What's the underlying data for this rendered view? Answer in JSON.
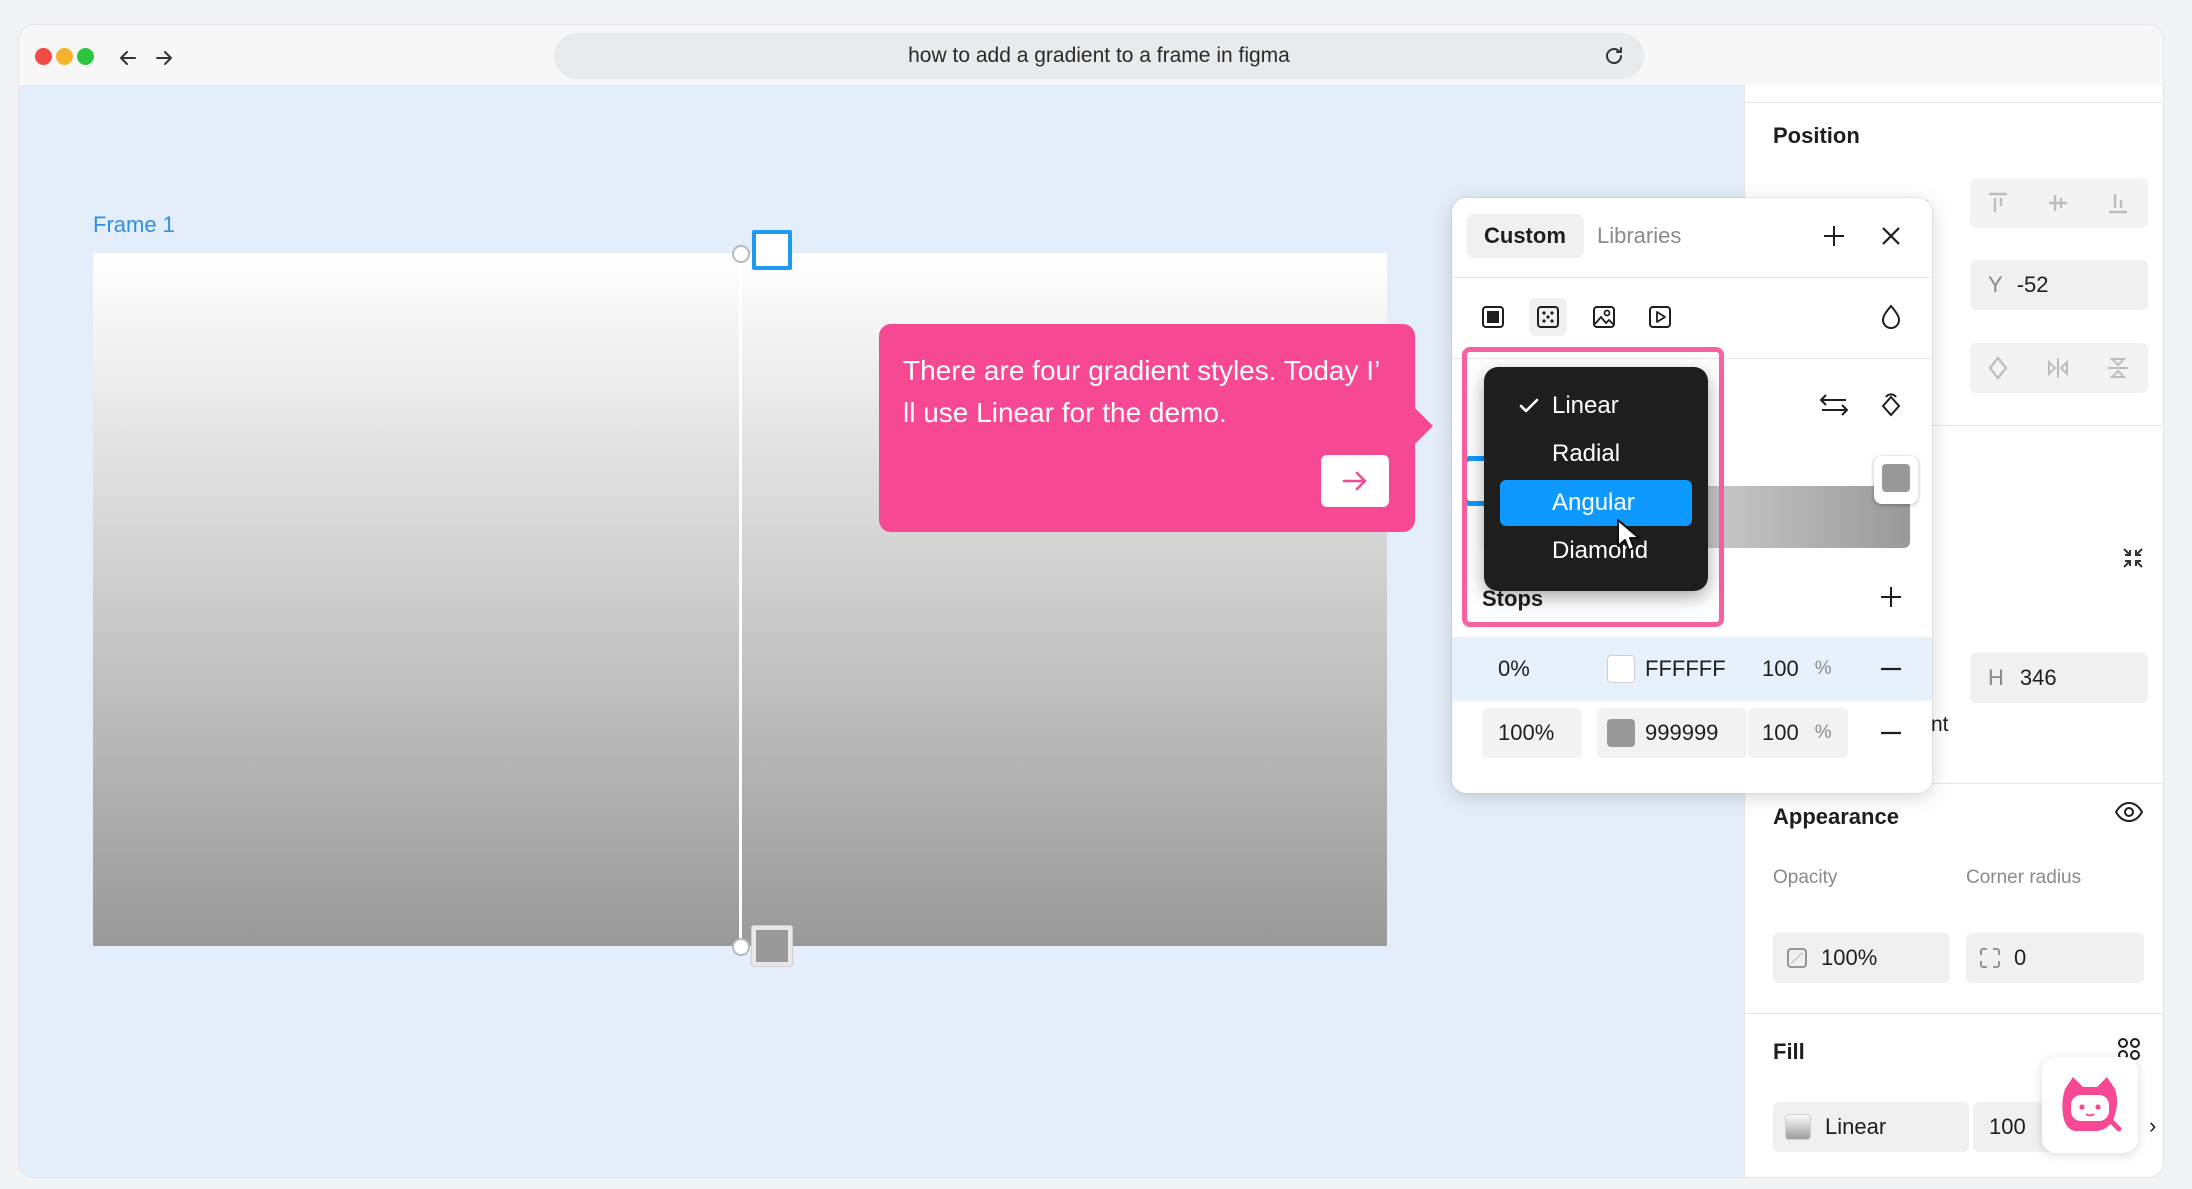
{
  "browser": {
    "url_text": "how to add a gradient to a frame in figma"
  },
  "canvas": {
    "frame_label": "Frame 1"
  },
  "tooltip": {
    "text": "There are four gradient styles. Today I’ ll use Linear for the demo."
  },
  "picker": {
    "tabs": [
      "Custom",
      "Libraries"
    ],
    "active_tab": "Custom",
    "gradient_menu": {
      "items": [
        "Linear",
        "Radial",
        "Angular",
        "Diamond"
      ],
      "checked": "Linear",
      "hovered": "Angular"
    },
    "stops_label": "Stops",
    "stops": [
      {
        "position": "0%",
        "hex": "FFFFFF",
        "color": "#ffffff",
        "opacity": "100",
        "unit": "%"
      },
      {
        "position": "100%",
        "hex": "999999",
        "color": "#999999",
        "opacity": "100",
        "unit": "%"
      }
    ]
  },
  "panel": {
    "position_label": "Position",
    "y_label": "Y",
    "y_value": "-52",
    "h_label": "H",
    "h_value": "346",
    "clipped_text": "nt",
    "appearance_label": "Appearance",
    "opacity_label": "Opacity",
    "opacity_value": "100%",
    "corner_radius_label": "Corner radius",
    "corner_radius_value": "0",
    "fill_label": "Fill",
    "fill_type": "Linear",
    "fill_opacity": "100"
  },
  "colors": {
    "accent_blue": "#0d99ff",
    "tooltip_pink": "#f64893",
    "frame_label_blue": "#2d8fe6",
    "canvas_bg": "#e4eefa"
  }
}
